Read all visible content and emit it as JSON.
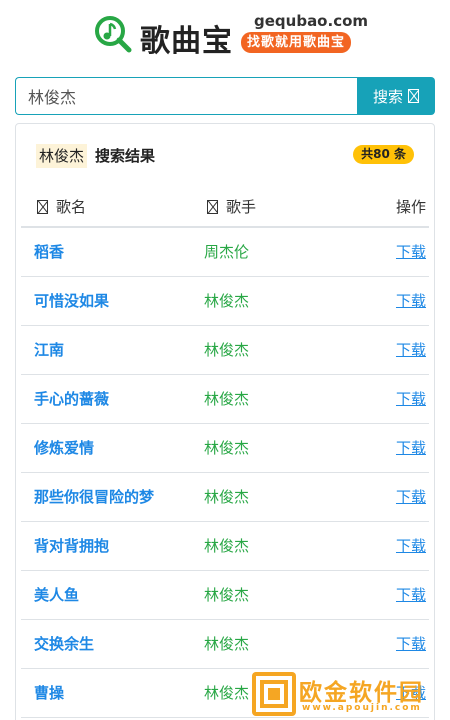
{
  "site": {
    "logo_text": "歌曲宝",
    "domain": "gequbao.com",
    "slogan": "找歌就用歌曲宝",
    "accent_color": "#17a2b8",
    "slogan_color": "#f26522"
  },
  "search": {
    "value": "林俊杰",
    "button_label": "搜索"
  },
  "results": {
    "query": "林俊杰",
    "title": "搜索结果",
    "count": "共80 条",
    "columns": {
      "name": "歌名",
      "artist": "歌手",
      "action": "操作"
    },
    "rows": [
      {
        "song": "稻香",
        "artist": "周杰伦",
        "action": "下载"
      },
      {
        "song": "可惜没如果",
        "artist": "林俊杰",
        "action": "下载"
      },
      {
        "song": "江南",
        "artist": "林俊杰",
        "action": "下载"
      },
      {
        "song": "手心的蔷薇",
        "artist": "林俊杰",
        "action": "下载"
      },
      {
        "song": "修炼爱情",
        "artist": "林俊杰",
        "action": "下载"
      },
      {
        "song": "那些你很冒险的梦",
        "artist": "林俊杰",
        "action": "下载"
      },
      {
        "song": "背对背拥抱",
        "artist": "林俊杰",
        "action": "下载"
      },
      {
        "song": "美人鱼",
        "artist": "林俊杰",
        "action": "下载"
      },
      {
        "song": "交换余生",
        "artist": "林俊杰",
        "action": "下载"
      },
      {
        "song": "曹操",
        "artist": "林俊杰",
        "action": "下载"
      }
    ]
  },
  "watermark": {
    "text": "欧金软件园",
    "url": "www.apoujin.com"
  }
}
